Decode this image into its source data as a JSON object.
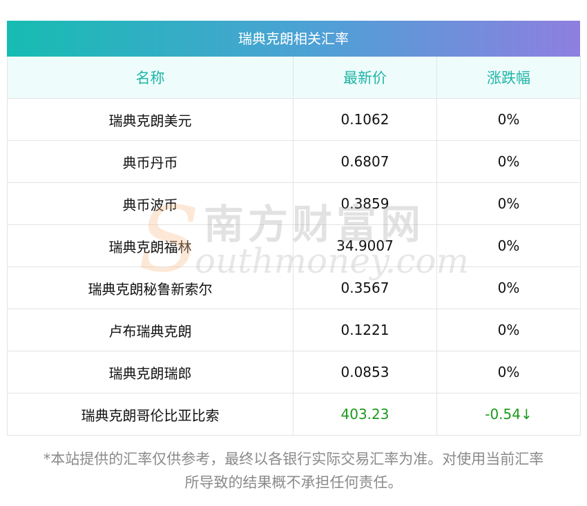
{
  "table": {
    "title": "瑞典克朗相关汇率",
    "headers": {
      "name": "名称",
      "price": "最新价",
      "change": "涨跌幅"
    },
    "rows": [
      {
        "name": "瑞典克朗美元",
        "price": "0.1062",
        "change": "0%"
      },
      {
        "name": "典币丹币",
        "price": "0.6807",
        "change": "0%"
      },
      {
        "name": "典币波币",
        "price": "0.3859",
        "change": "0%"
      },
      {
        "name": "瑞典克朗福林",
        "price": "34.9007",
        "change": "0%"
      },
      {
        "name": "瑞典克朗秘鲁新索尔",
        "price": "0.3567",
        "change": "0%"
      },
      {
        "name": "卢布瑞典克朗",
        "price": "0.1221",
        "change": "0%"
      },
      {
        "name": "瑞典克朗瑞郎",
        "price": "0.0853",
        "change": "0%"
      },
      {
        "name": "瑞典克朗哥伦比亚比索",
        "price": "403.23",
        "change": "-0.54↓"
      }
    ]
  },
  "watermark": {
    "letter": "S",
    "chinese": "南方财富网",
    "english": "outhmoney.com"
  },
  "disclaimer": {
    "line1": "*本站提供的汇率仅供参考，最终以各银行实际交易汇率为准。对使用当前汇率",
    "line2": "所导致的结果概不承担任何责任。"
  },
  "colors": {
    "header_text": "#1fb5a6",
    "header_bg": "#effcfc",
    "down": "#1a9a1a",
    "title_gradient_start": "#16bcb2",
    "title_gradient_end": "#8e7fdf"
  }
}
